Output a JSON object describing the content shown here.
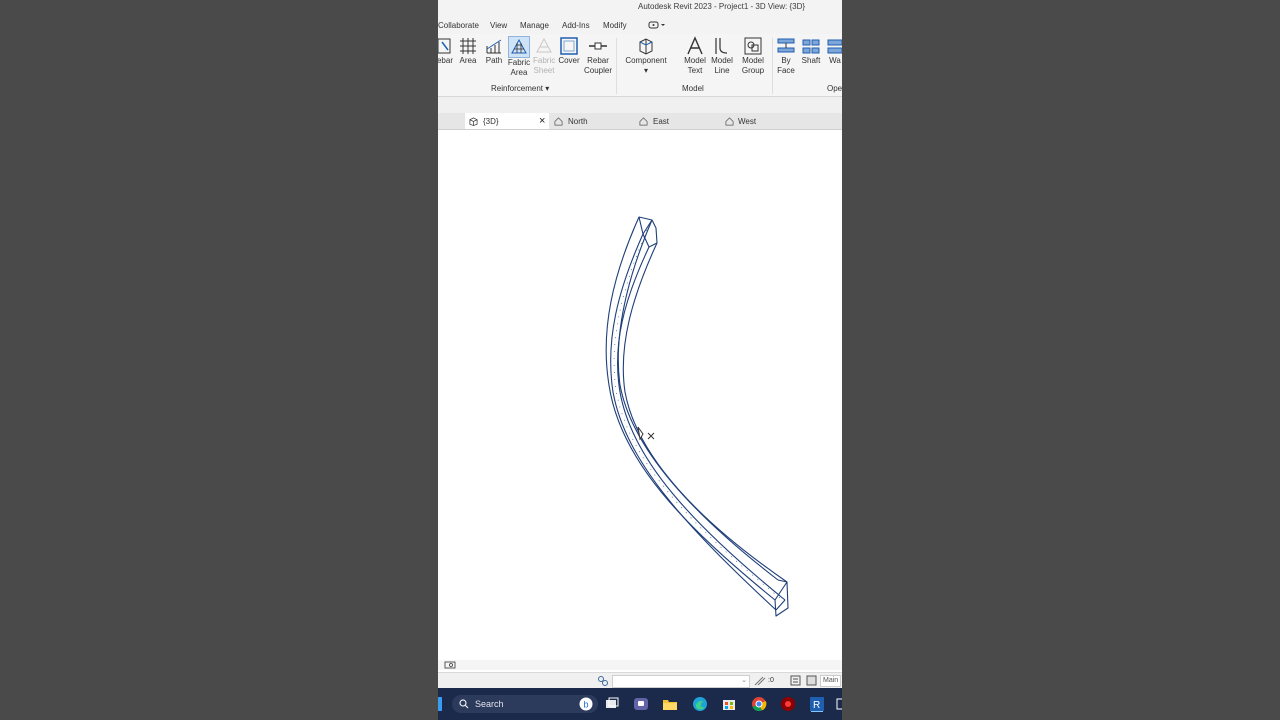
{
  "window": {
    "title": "Autodesk Revit 2023 - Project1 - 3D View: {3D}"
  },
  "ribbon_tabs": [
    "Collaborate",
    "View",
    "Manage",
    "Add-Ins",
    "Modify"
  ],
  "ribbon": {
    "tools": [
      {
        "label": "ebar",
        "icon": "rebar-icon"
      },
      {
        "label": "Area",
        "icon": "area-reinforcement-icon"
      },
      {
        "label": "Path",
        "icon": "path-reinforcement-icon"
      },
      {
        "label": "Fabric\nArea",
        "icon": "fabric-area-icon"
      },
      {
        "label": "Fabric\nSheet",
        "icon": "fabric-sheet-icon",
        "disabled": true
      },
      {
        "label": "Cover",
        "icon": "cover-icon"
      },
      {
        "label": "Rebar\nCoupler",
        "icon": "rebar-coupler-icon"
      },
      {
        "label": "Component",
        "icon": "component-icon"
      },
      {
        "label": "Model\nText",
        "icon": "model-text-icon"
      },
      {
        "label": "Model\nLine",
        "icon": "model-line-icon"
      },
      {
        "label": "Model\nGroup",
        "icon": "model-group-icon"
      },
      {
        "label": "By\nFace",
        "icon": "by-face-icon"
      },
      {
        "label": "Shaft",
        "icon": "shaft-icon"
      },
      {
        "label": "Wa",
        "icon": "wall-opening-icon"
      }
    ],
    "panels": {
      "reinforcement": "Reinforcement",
      "model": "Model",
      "opening": "Ope"
    }
  },
  "view_tabs": {
    "active": "{3D}",
    "others": [
      "North",
      "East",
      "West"
    ]
  },
  "statusbar": {
    "selection_count": ":0",
    "workset": "Main"
  },
  "taskbar": {
    "search_label": "Search"
  },
  "colors": {
    "model_edge": "#1f3f7a",
    "taskbar": "#1b2a4a",
    "active_tool_bg": "#cfe3f7"
  }
}
